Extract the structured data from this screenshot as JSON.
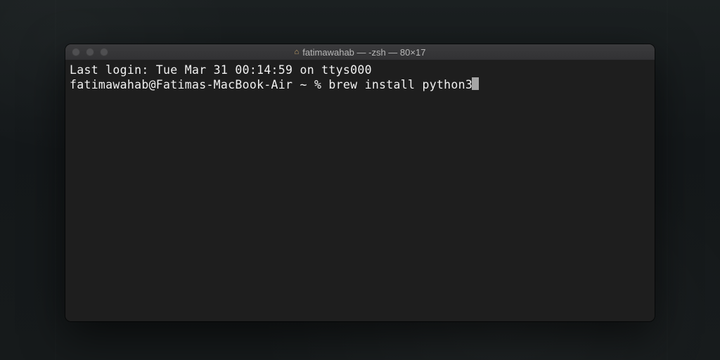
{
  "window": {
    "title": "fatimawahab — -zsh — 80×17",
    "home_icon": "home-icon"
  },
  "terminal": {
    "last_login": "Last login: Tue Mar 31 00:14:59 on ttys000",
    "prompt": "fatimawahab@Fatimas-MacBook-Air ~ % ",
    "command": "brew install python3"
  }
}
